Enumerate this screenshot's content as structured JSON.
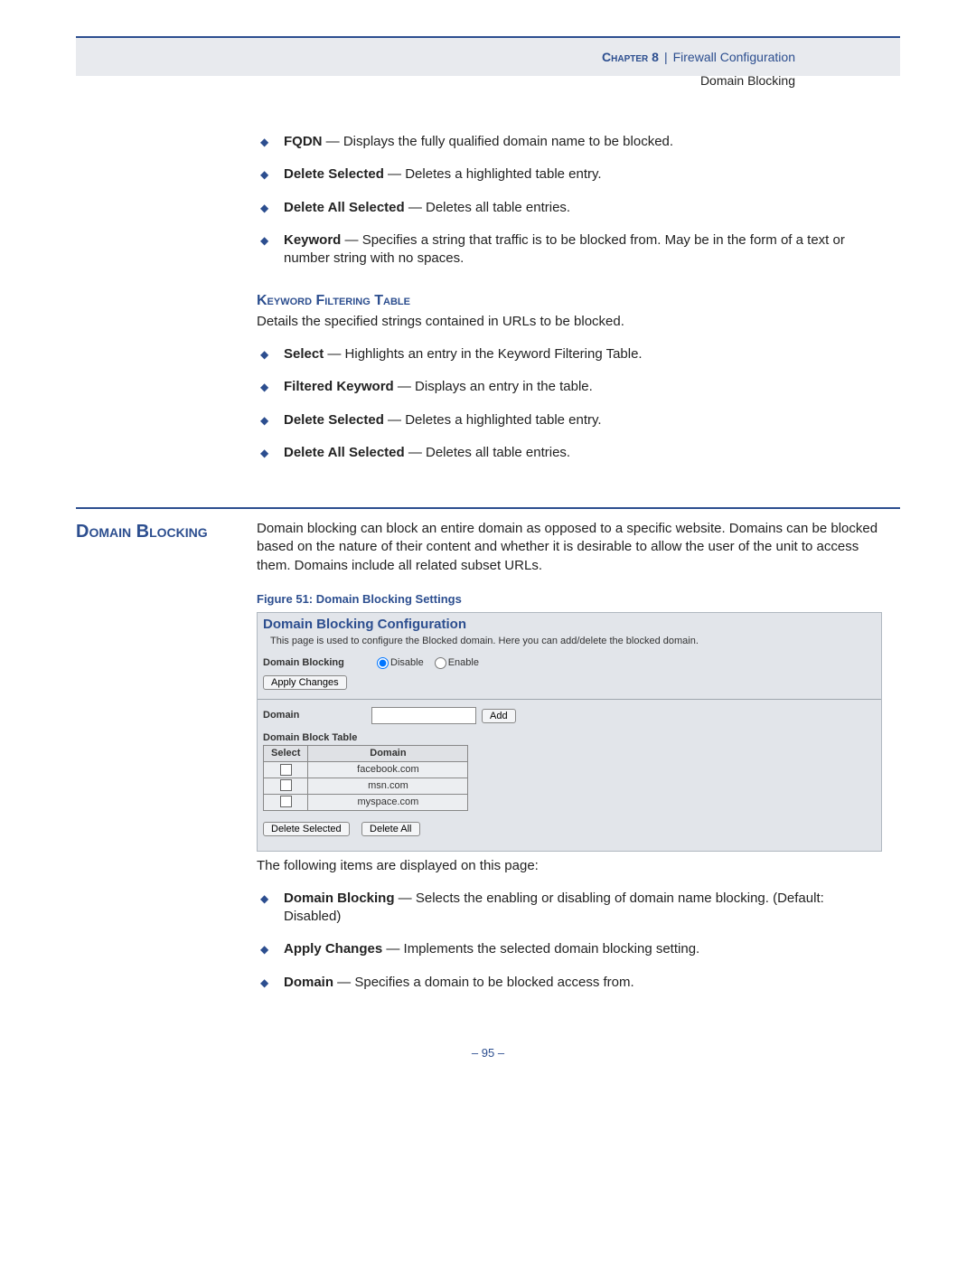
{
  "header": {
    "chapter_label": "Chapter 8",
    "separator": "|",
    "section": "Firewall Configuration",
    "subsection": "Domain Blocking"
  },
  "top_list": [
    {
      "term": "FQDN",
      "desc": " — Displays the fully qualified domain name to be blocked."
    },
    {
      "term": "Delete Selected",
      "desc": " — Deletes a highlighted table entry."
    },
    {
      "term": "Delete All Selected",
      "desc": " — Deletes all table entries."
    },
    {
      "term": "Keyword",
      "desc": " — Specifies a string that traffic is to be blocked from. May be in the form of a text or number string with no spaces."
    }
  ],
  "keyword_section": {
    "heading": "Keyword Filtering Table",
    "intro": "Details the specified strings contained in URLs to be blocked.",
    "items": [
      {
        "term": "Select",
        "desc": " — Highlights an entry in the Keyword Filtering Table."
      },
      {
        "term": "Filtered Keyword",
        "desc": " — Displays an entry in the table."
      },
      {
        "term": "Delete Selected",
        "desc": " — Deletes a highlighted table entry."
      },
      {
        "term": "Delete All Selected",
        "desc": " — Deletes all table entries."
      }
    ]
  },
  "domain_blocking": {
    "title": "Domain Blocking",
    "intro": "Domain blocking can block an entire domain as opposed to a specific website. Domains can be blocked based on the nature of their content and whether it is desirable to allow the user of the unit to access them. Domains include all related subset URLs.",
    "figure_caption": "Figure 51:  Domain Blocking Settings",
    "ui": {
      "title": "Domain Blocking Configuration",
      "desc": "This page is used to configure the Blocked domain. Here you can add/delete the blocked domain.",
      "label_blocking": "Domain Blocking",
      "radio_disable": "Disable",
      "radio_enable": "Enable",
      "btn_apply": "Apply Changes",
      "label_domain": "Domain",
      "btn_add": "Add",
      "table_title": "Domain Block Table",
      "col_select": "Select",
      "col_domain": "Domain",
      "rows": [
        "facebook.com",
        "msn.com",
        "myspace.com"
      ],
      "btn_delete_selected": "Delete Selected",
      "btn_delete_all": "Delete All"
    },
    "after_figure": "The following items are displayed on this page:",
    "after_list": [
      {
        "term": "Domain Blocking",
        "desc": " — Selects the enabling or disabling of domain name blocking. (Default: Disabled)"
      },
      {
        "term": "Apply Changes",
        "desc": " — Implements the selected domain blocking setting."
      },
      {
        "term": "Domain",
        "desc": " — Specifies a domain to be blocked access from."
      }
    ]
  },
  "page_number": "–  95  –"
}
